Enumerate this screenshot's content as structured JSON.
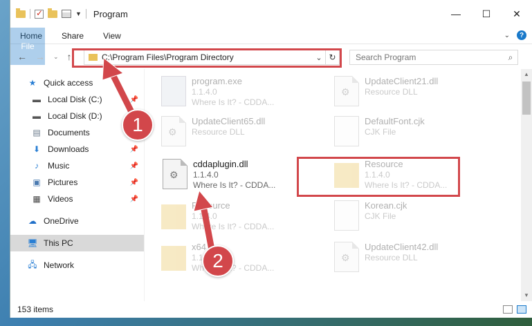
{
  "window": {
    "title": "Program"
  },
  "ribbon": {
    "file": "File",
    "home": "Home",
    "share": "Share",
    "view": "View"
  },
  "address": {
    "path": "C:\\Program Files\\Program Directory"
  },
  "search": {
    "placeholder": "Search Program"
  },
  "sidebar": {
    "items": [
      {
        "label": "Quick access"
      },
      {
        "label": "Local Disk (C:)"
      },
      {
        "label": "Local Disk (D:)"
      },
      {
        "label": "Documents"
      },
      {
        "label": "Downloads"
      },
      {
        "label": "Music"
      },
      {
        "label": "Pictures"
      },
      {
        "label": "Videos"
      },
      {
        "label": "OneDrive"
      },
      {
        "label": "This PC"
      },
      {
        "label": "Network"
      }
    ]
  },
  "files": [
    {
      "name": "program.exe",
      "line1": "1.1.4.0",
      "line2": "Where Is It? - CDDA..."
    },
    {
      "name": "UpdateClient21.dll",
      "line1": "Resource DLL",
      "line2": ""
    },
    {
      "name": "UpdateClient65.dll",
      "line1": "Resource DLL",
      "line2": ""
    },
    {
      "name": "DefaultFont.cjk",
      "line1": "CJK File",
      "line2": ""
    },
    {
      "name": "cddaplugin.dll",
      "line1": "1.1.4.0",
      "line2": "Where Is It? - CDDA..."
    },
    {
      "name": "Resource",
      "line1": "1.1.4.0",
      "line2": "Where Is It? - CDDA..."
    },
    {
      "name": "Resource",
      "line1": "1.1.4.0",
      "line2": "Where Is It? - CDDA..."
    },
    {
      "name": "Korean.cjk",
      "line1": "CJK File",
      "line2": ""
    },
    {
      "name": "x64",
      "line1": "1.1.4.0",
      "line2": "Where Is It? - CDDA..."
    },
    {
      "name": "UpdateClient42.dll",
      "line1": "Resource DLL",
      "line2": ""
    }
  ],
  "status": {
    "count": "153 items"
  },
  "annotations": {
    "step1": "1",
    "step2": "2",
    "color": "#d2474b"
  }
}
